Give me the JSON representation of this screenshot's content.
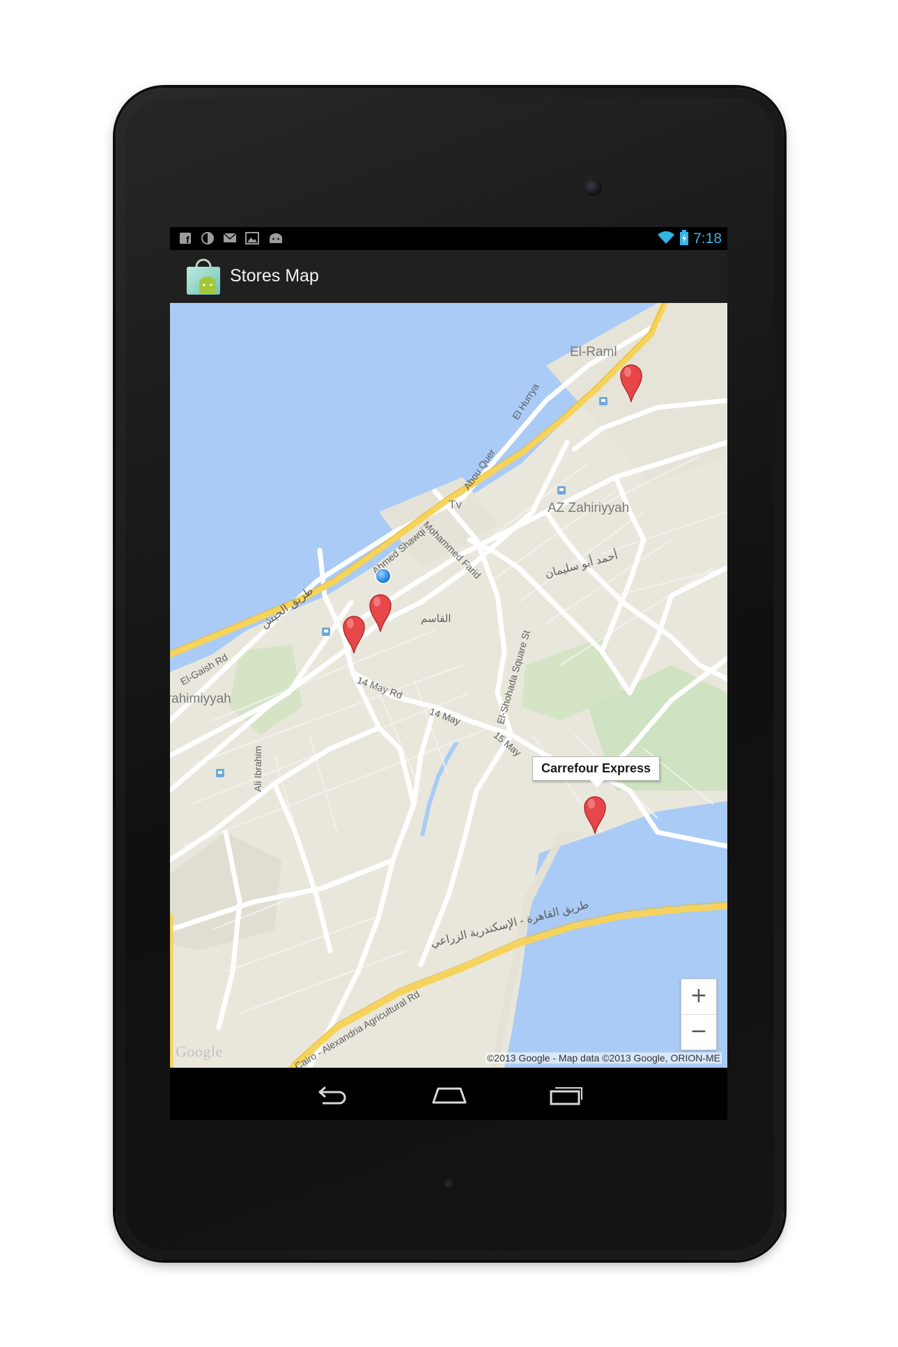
{
  "status_bar": {
    "time": "7:18",
    "notification_icons": [
      "facebook-icon",
      "contrast-icon",
      "mail-icon",
      "gallery-icon",
      "android-icon"
    ],
    "system_icons": [
      "wifi-icon",
      "battery-charging-icon"
    ],
    "clock_color": "#33b5e5"
  },
  "action_bar": {
    "title": "Stores Map",
    "app_icon": "shopping-bag-android-icon"
  },
  "map": {
    "labels": {
      "el_raml": "El-Raml",
      "el_hurrya": "El Hurrya",
      "abou_quer": "Abou Quer",
      "tv": "Tv",
      "az_zahiriyyah": "AZ Zahiriyyah",
      "ahmed_shawqi": "Ahmed Shawqi",
      "mohammed_farid": "Mohammed Farid",
      "ahmed_abu_soliman": "أحمد أبو سليمان",
      "tariq_el_geish": "طريق الجيش",
      "el_gaish_rd": "El-Gaish Rd",
      "el_kasem": "القاسم",
      "el_shohada_square": "El-Shohada Square St",
      "fourteen_may_rd": "14 May Rd",
      "fourteen_may": "14 May",
      "fifteen_may": "15 May",
      "ibrahimiyyah": "Ibrahimiyyah",
      "ali_ibrahim": "Ali Ibrahim",
      "cairo_alex_agri_ar": "طريق القاهرة - الإسكندرية الزراعي",
      "cairo_alex_agri_en": "Cairo - Alexandria Agricultural Rd"
    },
    "info_window": "Carrefour Express",
    "zoom_in": "+",
    "zoom_out": "−",
    "google_logo": "Google",
    "attribution": "©2013 Google - Map data ©2013 Google, ORION-ME",
    "colors": {
      "water": "#a9cbf5",
      "land": "#e9e7dc",
      "park": "#cfe2c1",
      "highway": "#f6d35c",
      "road": "#ffffff",
      "marker": "#e8474a"
    }
  },
  "nav_bar": {
    "icons": [
      "back-icon",
      "home-icon",
      "recent-apps-icon"
    ]
  }
}
